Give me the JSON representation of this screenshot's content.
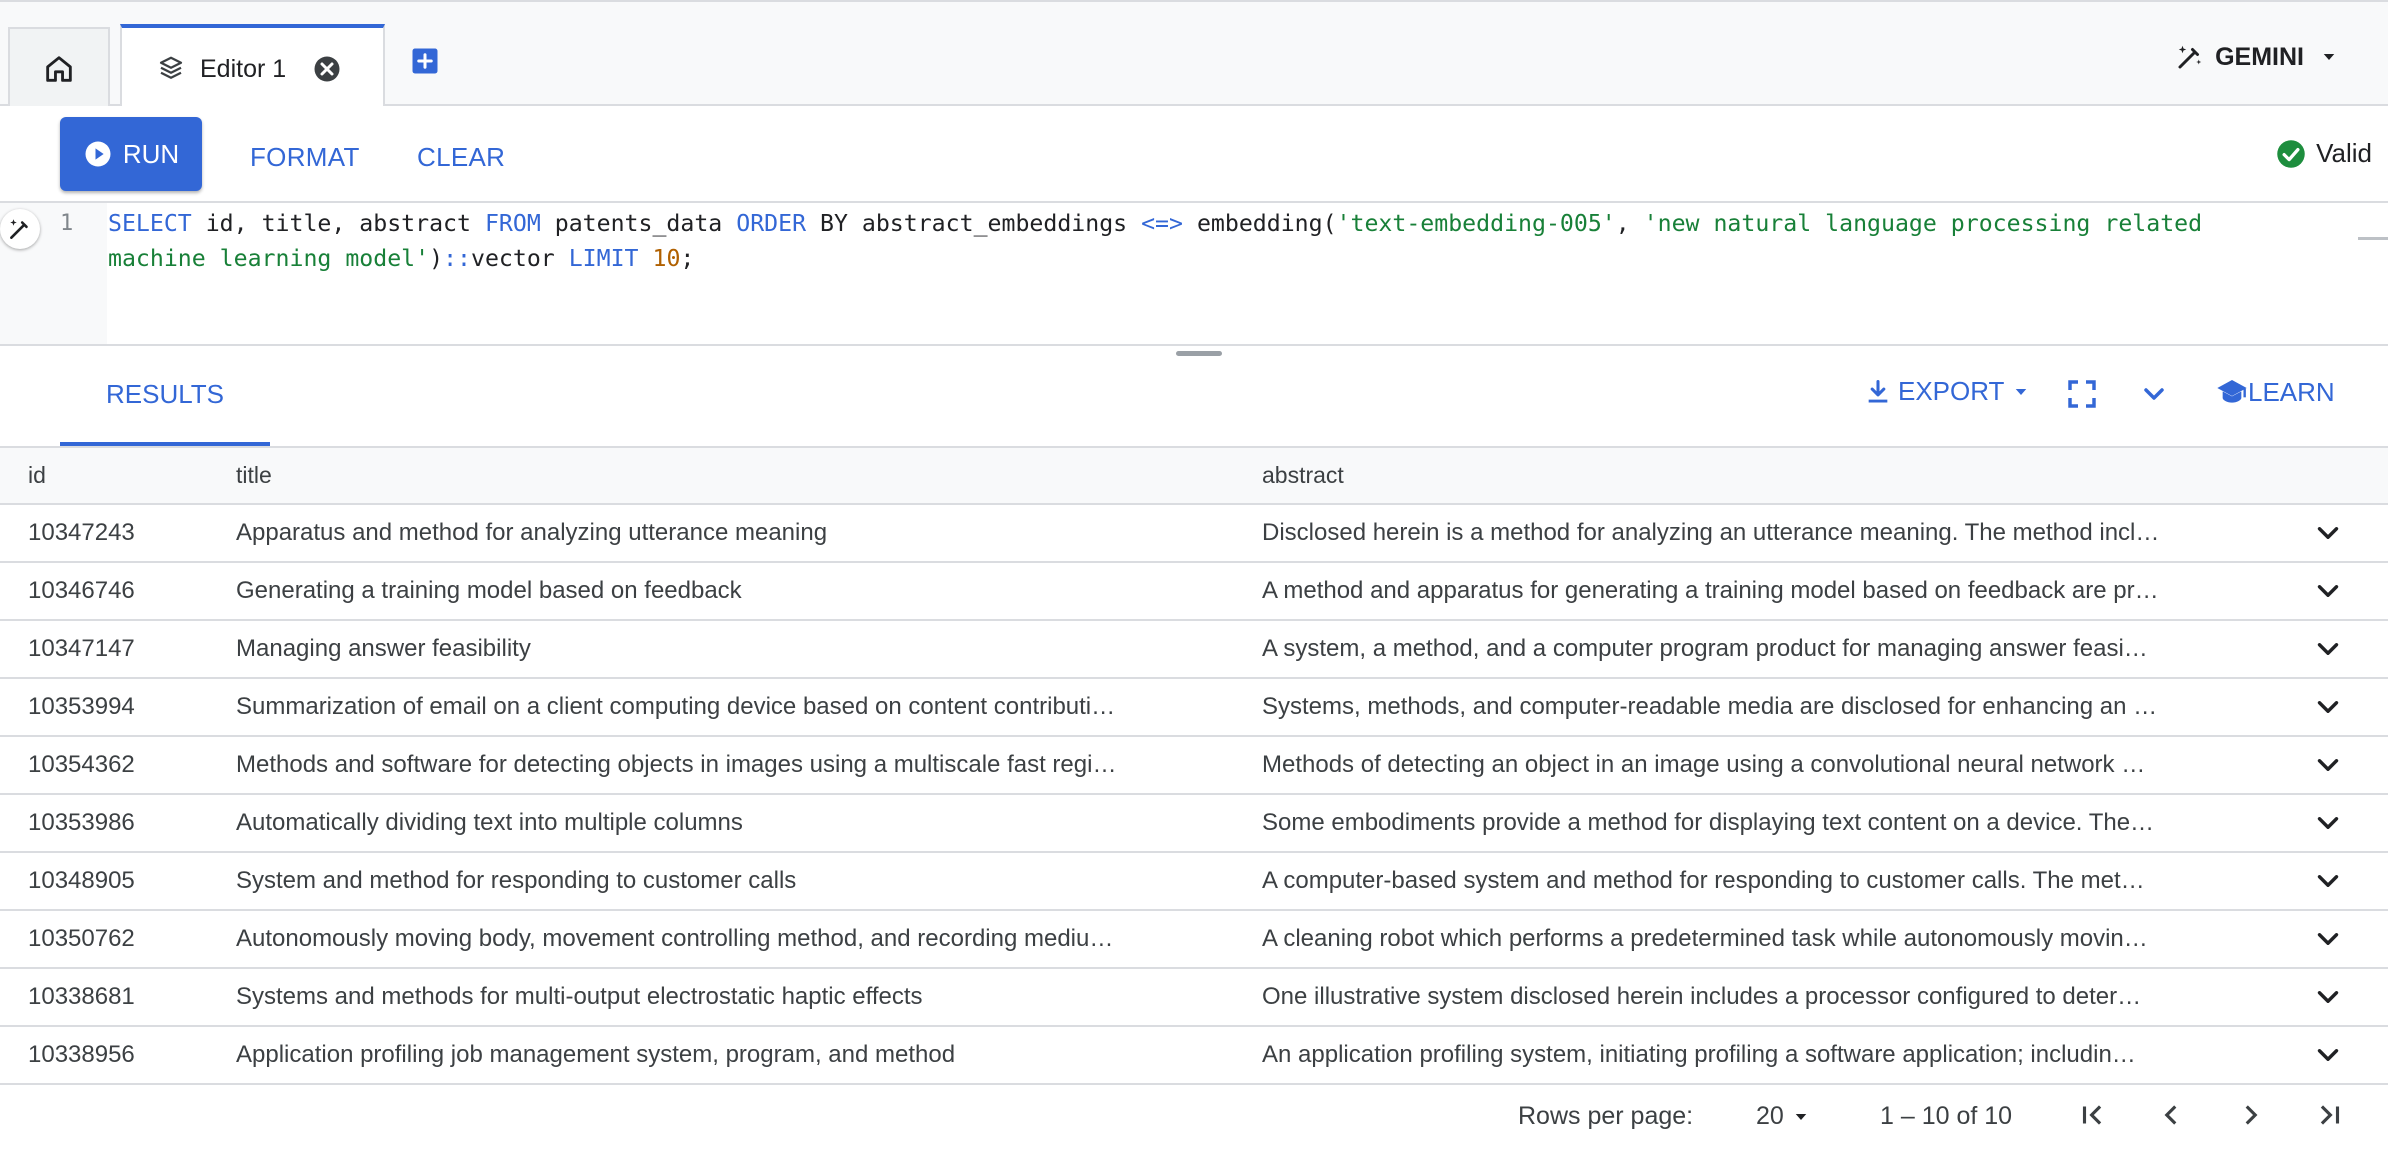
{
  "tabs": {
    "editor_tab_label": "Editor 1",
    "gemini_label": "GEMINI"
  },
  "toolbar": {
    "run_label": "RUN",
    "format_label": "FORMAT",
    "clear_label": "CLEAR",
    "status_label": "Valid"
  },
  "editor": {
    "line_number": "1",
    "query": "SELECT id, title, abstract FROM patents_data ORDER BY abstract_embeddings <=> embedding('text-embedding-005', 'new natural language processing related machine learning model')::vector LIMIT 10;"
  },
  "results": {
    "tab_label": "RESULTS",
    "export_label": "EXPORT",
    "learn_label": "LEARN",
    "columns": [
      "id",
      "title",
      "abstract"
    ],
    "rows": [
      {
        "id": "10347243",
        "title": "Apparatus and method for analyzing utterance meaning",
        "abstract": "Disclosed herein is a method for analyzing an utterance meaning. The method incl…"
      },
      {
        "id": "10346746",
        "title": "Generating a training model based on feedback",
        "abstract": "A method and apparatus for generating a training model based on feedback are pr…"
      },
      {
        "id": "10347147",
        "title": "Managing answer feasibility",
        "abstract": "A system, a method, and a computer program product for managing answer feasi…"
      },
      {
        "id": "10353994",
        "title": "Summarization of email on a client computing device based on content contributi…",
        "abstract": "Systems, methods, and computer-readable media are disclosed for enhancing an …"
      },
      {
        "id": "10354362",
        "title": "Methods and software for detecting objects in images using a multiscale fast regi…",
        "abstract": "Methods of detecting an object in an image using a convolutional neural network …"
      },
      {
        "id": "10353986",
        "title": "Automatically dividing text into multiple columns",
        "abstract": "Some embodiments provide a method for displaying text content on a device. The…"
      },
      {
        "id": "10348905",
        "title": "System and method for responding to customer calls",
        "abstract": "A computer-based system and method for responding to customer calls. The met…"
      },
      {
        "id": "10350762",
        "title": "Autonomously moving body, movement controlling method, and recording mediu…",
        "abstract": "A cleaning robot which performs a predetermined task while autonomously movin…"
      },
      {
        "id": "10338681",
        "title": "Systems and methods for multi-output electrostatic haptic effects",
        "abstract": "One illustrative system disclosed herein includes a processor configured to deter…"
      },
      {
        "id": "10338956",
        "title": "Application profiling job management system, program, and method",
        "abstract": "An application profiling system, initiating profiling a software application; includin…"
      }
    ]
  },
  "footer": {
    "rows_per_page_label": "Rows per page:",
    "rows_per_page_value": "20",
    "range_label": "1 – 10 of 10"
  },
  "colors": {
    "accent": "#3367d6",
    "valid_green": "#1e8e3e",
    "border": "#dadce0"
  },
  "icons": [
    "home-icon",
    "database-icon",
    "close-circle-icon",
    "add-tab-icon",
    "pen-sparkle-icon",
    "caret-down-icon",
    "play-circle-icon",
    "check-circle-icon",
    "download-icon",
    "fullscreen-icon",
    "chevron-down-icon",
    "school-icon",
    "first-page-icon",
    "prev-page-icon",
    "next-page-icon",
    "last-page-icon"
  ]
}
